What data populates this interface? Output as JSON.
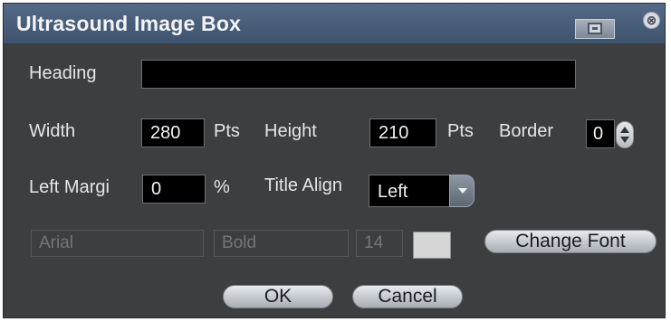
{
  "window": {
    "title": "Ultrasound Image Box",
    "min_icon": "minimize-window-icon",
    "close_icon": "close-icon",
    "close_glyph": "⊗"
  },
  "heading": {
    "label": "Heading",
    "value": ""
  },
  "width": {
    "label": "Width",
    "value": "280",
    "unit": "Pts"
  },
  "height": {
    "label": "Height",
    "value": "210",
    "unit": "Pts"
  },
  "border": {
    "label": "Border",
    "value": "0"
  },
  "left_margin": {
    "label": "Left Margi",
    "value": "0",
    "unit": "%"
  },
  "title_align": {
    "label": "Title Align",
    "selected": "Left"
  },
  "font": {
    "family": "Arial",
    "style": "Bold",
    "size": "14",
    "color": "#d6d6d6",
    "change_label": "Change Font"
  },
  "buttons": {
    "ok": "OK",
    "cancel": "Cancel"
  }
}
